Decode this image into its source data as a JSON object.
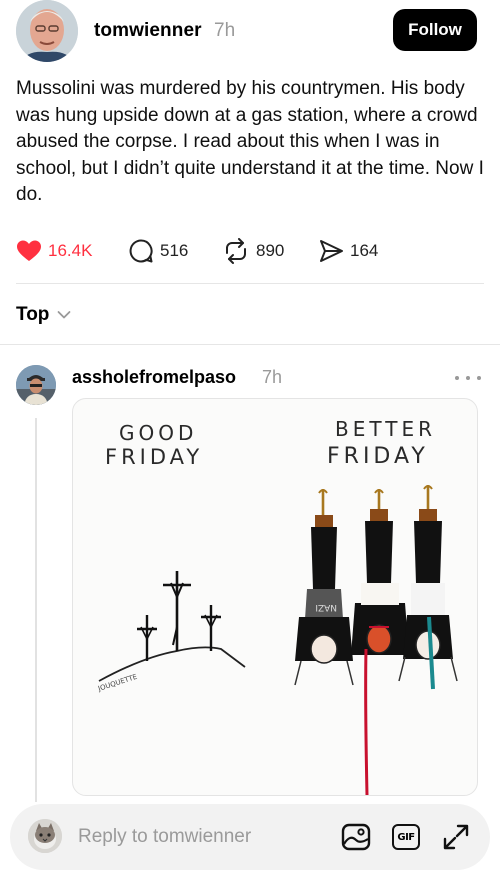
{
  "post": {
    "username": "tomwienner",
    "time": "7h",
    "follow_label": "Follow",
    "text": "Mussolini was murdered by his countrymen. His body was hung upside down at a gas station, where a crowd abused the corpse.  I read about this when I was in school, but I didn’t quite understand it at the time.  Now I do.",
    "stats": {
      "likes": "16.4K",
      "comments": "516",
      "reposts": "890",
      "shares": "164"
    },
    "liked": true,
    "like_color": "#ff3040"
  },
  "sort": {
    "label": "Top"
  },
  "reply": {
    "username": "assholefromelpaso",
    "time": "7h",
    "image": {
      "left_title_line1": "GOOD",
      "left_title_line2": "FRIDAY",
      "right_title_line1": "BETTER",
      "right_title_line2": "FRIDAY",
      "signature": "JOUQUETTE",
      "shirt_text": "NAZI"
    }
  },
  "composer": {
    "placeholder": "Reply to tomwienner",
    "gif_label": "GIF",
    "icons": [
      "image-icon",
      "gif-icon",
      "expand-icon"
    ]
  },
  "colors": {
    "primary_button": "#000000",
    "secondary_text": "#9a9a9a",
    "rope": "#a8781f",
    "blood": "#c8102e"
  }
}
